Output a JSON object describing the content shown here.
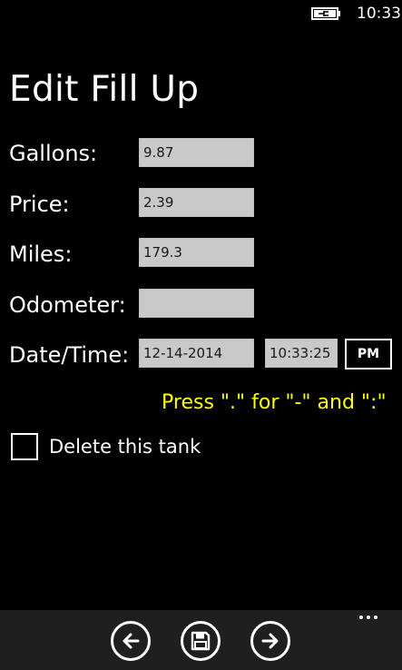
{
  "status": {
    "time": "10:33"
  },
  "title": "Edit Fill Up",
  "form": {
    "gallons": {
      "label": "Gallons:",
      "value": "9.87"
    },
    "price": {
      "label": "Price:",
      "value": "2.39"
    },
    "miles": {
      "label": "Miles:",
      "value": "179.3"
    },
    "odometer": {
      "label": "Odometer:",
      "value": ""
    },
    "datetime": {
      "label": "Date/Time:",
      "date": "12-14-2014",
      "time": "10:33:25",
      "ampm": "PM"
    }
  },
  "hint": "Press \".\" for \"-\" and \":\"",
  "delete_label": "Delete this tank",
  "app_bar": {
    "icons": [
      "back-arrow-icon",
      "save-icon",
      "forward-arrow-icon",
      "more-icon"
    ]
  },
  "colors": {
    "background": "#000000",
    "hint": "#ffff00",
    "field": "#c9c9c9",
    "app_bar": "#1f1f1f"
  }
}
